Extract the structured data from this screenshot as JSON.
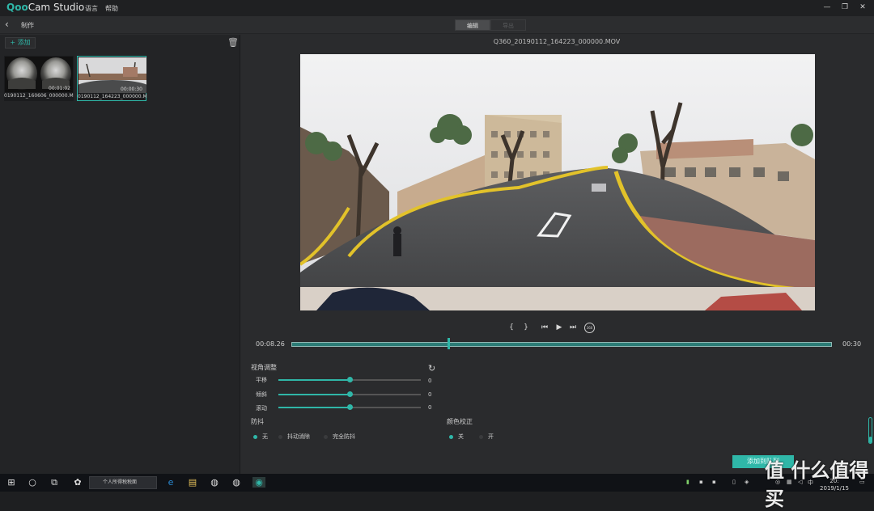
{
  "app": {
    "brand_q": "Qoo",
    "brand_rest": "Cam Studio",
    "menus": [
      "语言",
      "帮助"
    ],
    "window_controls": [
      "—",
      "❐",
      "✕"
    ]
  },
  "toolbar": {
    "back": "‹",
    "crumb": "制作",
    "tabs": [
      {
        "label": "编辑",
        "active": true
      },
      {
        "label": "导出",
        "active": false
      }
    ]
  },
  "library": {
    "add_label": "+ 添加",
    "delete_icon": "trash-icon",
    "items": [
      {
        "name": "0190112_160606_000000.MOV",
        "duration": "00:01:02",
        "selected": false
      },
      {
        "name": "0190112_164223_000000.MOV",
        "duration": "00:00:30",
        "selected": true
      }
    ]
  },
  "editor": {
    "filename": "Q360_20190112_164223_000000.MOV",
    "current_time": "00:08.26",
    "total_time": "00:30",
    "progress_fraction": 0.29,
    "playback_icons": [
      "{",
      "}",
      "⏮",
      "▶",
      "⏭",
      "360"
    ]
  },
  "view_adjust": {
    "title": "视角调整",
    "sliders": [
      {
        "label": "平移",
        "value": "0",
        "level": 0.5
      },
      {
        "label": "倾斜",
        "value": "0",
        "level": 0.5
      },
      {
        "label": "滚动",
        "value": "0",
        "level": 0.5
      }
    ]
  },
  "stabilization": {
    "title": "防抖",
    "options": [
      {
        "label": "无",
        "selected": true
      },
      {
        "label": "抖动消除",
        "selected": false
      },
      {
        "label": "完全防抖",
        "selected": false
      }
    ]
  },
  "color_correction": {
    "title": "颜色校正",
    "options": [
      {
        "label": "关",
        "selected": true
      },
      {
        "label": "开",
        "selected": false
      }
    ]
  },
  "export_button": "添加到队列",
  "taskbar": {
    "search_placeholder": "个人所得税税面",
    "date": "2019/1/15",
    "time": "20:",
    "ime": "中"
  },
  "watermark": "值 什么值得买",
  "colors": {
    "accent": "#2fb7a8",
    "panel": "#232426",
    "bg": "#2a2b2d"
  }
}
